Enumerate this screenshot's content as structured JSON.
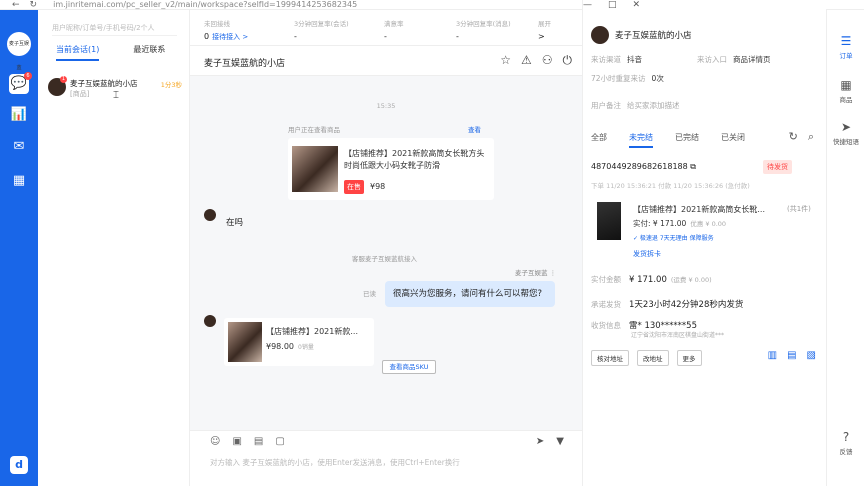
{
  "browser": {
    "nav": [
      "←",
      "↻"
    ],
    "url": "im.jinritemai.com/pc_seller_v2/main/workspace?selfId=1999414253682345",
    "controls": [
      "—",
      "□",
      "✕"
    ]
  },
  "leftnav": {
    "avatar_text": "麦子互娱蓝",
    "badge": "6",
    "items": [
      "💬",
      "📊",
      "✉",
      "▦"
    ],
    "brand": "d"
  },
  "convpanel": {
    "search_placeholder": "用户昵称/订单号/手机号码/2个人",
    "tabs": [
      "当前会话(1)",
      "最近联系"
    ],
    "conversation": {
      "badge": "1",
      "name": "麦子互娱蓝航的小店",
      "sub": "[商品]",
      "time": "1分3秒"
    }
  },
  "metrics": [
    {
      "label": "未回接线",
      "value": "0",
      "link": "接待接入 >"
    },
    {
      "label": "3分钟回复率(会话)",
      "value": "-"
    },
    {
      "label": "满意率",
      "value": "-"
    },
    {
      "label": "3分钟回复率(消息)",
      "value": "-"
    },
    {
      "label": "展开",
      "value": ">"
    }
  ],
  "chat": {
    "title": "麦子互娱蓝航的小店",
    "header_icons": [
      "☆",
      "⚠",
      "⚇",
      "⏻"
    ],
    "timestamp1": "15:35",
    "system_text": "用户正在查看商品",
    "system_link": "查看",
    "product1": {
      "title": "【店铺推荐】2021新款高筒女长靴方头时尚低跟大小码女靴子防滑",
      "tag": "在售",
      "price": "¥98"
    },
    "msg_left": "在吗",
    "transfer_text": "客服麦子互娱蓝航接入",
    "agent_name": "麦子互娱蓝  ⋮",
    "msg_right": "很高兴为您服务，请问有什么可以帮您?",
    "read_label": "已读",
    "product2": {
      "title": "【店铺推荐】2021新款...",
      "price": "¥98.00",
      "sold": "0销量"
    },
    "sku_button": "查看商品SKU",
    "input_tools": [
      "☺",
      "▣",
      "▤",
      "▢"
    ],
    "send_icons": [
      "➤",
      "▼"
    ],
    "input_placeholder": "对方输入 麦子互娱蓝航的小店，使用Enter发送消息，使用Ctrl+Enter换行"
  },
  "rightpanel": {
    "shop_name": "麦子互娱蓝航的小店",
    "source_label": "来访渠道",
    "source_value": "抖音",
    "entry_label": "来访入口",
    "entry_value": "商品详情页",
    "orders_label": "72小时重复来访",
    "orders_value": "0次",
    "note_label": "用户备注",
    "note_value": "给买家添加描述",
    "tabs": [
      "全部",
      "未完结",
      "已完结",
      "已关闭"
    ],
    "tab_icons": [
      "↻",
      "⌕"
    ],
    "order_id": "4870449289682618188  ⧉",
    "status": "待发货",
    "times": "下单 11/20 15:36:21   付款 11/20 15:36:26 (急付款)",
    "order_title": "【店铺推荐】2021新款高筒女长靴...",
    "order_count": "(共1件)",
    "paid": "实付: ¥ 171.00",
    "paid_note": "优惠 ¥ 0.00",
    "tags": "✓ 极速退  7天无理由  保障服务",
    "ship_link": "发货拆卡",
    "amount_label": "实付金额",
    "amount_value": "¥ 171.00",
    "amount_note": "(运费 ¥ 0.00)",
    "promise_label": "承诺发货",
    "promise_value": "1天23小时42分钟28秒内发货",
    "recv_label": "收货信息",
    "recv_value": "雷*  130******55",
    "recv_addr": "辽宁省沈阳市浑南区棋盘山街道***",
    "buttons": [
      "核对地址",
      "改地址",
      "更多"
    ],
    "bottom_icons": [
      "▥",
      "▤",
      "▧"
    ]
  },
  "rightbar": {
    "items": [
      {
        "icon": "☰",
        "label": "订单"
      },
      {
        "icon": "▦",
        "label": "商品"
      },
      {
        "icon": "➤",
        "label": "快捷短语"
      },
      {
        "icon": "?",
        "label": "反馈"
      }
    ]
  }
}
